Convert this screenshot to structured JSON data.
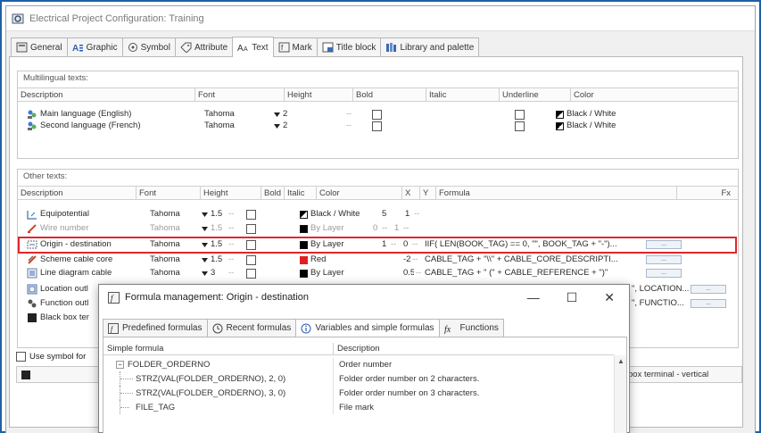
{
  "window": {
    "title": "Electrical Project Configuration: Training"
  },
  "tabs": [
    {
      "label": "General",
      "icon": "general-icon"
    },
    {
      "label": "Graphic",
      "icon": "graphic-icon"
    },
    {
      "label": "Symbol",
      "icon": "symbol-icon"
    },
    {
      "label": "Attribute",
      "icon": "attribute-icon"
    },
    {
      "label": "Text",
      "icon": "text-icon",
      "active": true
    },
    {
      "label": "Mark",
      "icon": "mark-icon"
    },
    {
      "label": "Title block",
      "icon": "title-block-icon"
    },
    {
      "label": "Library and palette",
      "icon": "library-icon"
    }
  ],
  "multilingual": {
    "title": "Multilingual texts:",
    "headers": [
      "Description",
      "Font",
      "Height",
      "Bold",
      "Italic",
      "Underline",
      "Color"
    ],
    "rows": [
      {
        "description": "Main language (English)",
        "font": "Tahoma",
        "height": "2",
        "bold": "--",
        "color": "Black / White"
      },
      {
        "description": "Second language (French)",
        "font": "Tahoma",
        "height": "2",
        "bold": "--",
        "color": "Black / White"
      }
    ]
  },
  "other": {
    "title": "Other texts:",
    "headers": [
      "Description",
      "Font",
      "Height",
      "Bold",
      "Italic",
      "Color",
      "X",
      "Y",
      "Formula",
      "Fx"
    ],
    "rows": [
      {
        "description": "Equipotential",
        "font": "Tahoma",
        "height": "1.5",
        "dash": "--",
        "color": "Black / White",
        "color_hex": "#000000",
        "x": "5",
        "y": "1",
        "y_dash": "--",
        "formula": "",
        "fx": "",
        "faded": false
      },
      {
        "description": "Wire number",
        "font": "Tahoma",
        "height": "1.5",
        "dash": "--",
        "color": "By Layer",
        "color_hex": "#000000",
        "x": "0",
        "x_dash": "--",
        "y": "1",
        "y_dash": "--",
        "formula": "",
        "fx": "",
        "faded": true
      },
      {
        "description": "Origin - destination",
        "font": "Tahoma",
        "height": "1.5",
        "dash": "--",
        "color": "By Layer",
        "color_hex": "#000000",
        "x": "1",
        "x_dash": "--",
        "y": "0",
        "y_dash": "--",
        "formula": "IIF( LEN(BOOK_TAG) == 0, \"\", BOOK_TAG + \"-\")...",
        "fx": "...",
        "faded": false
      },
      {
        "description": "Scheme cable core",
        "font": "Tahoma",
        "height": "1.5",
        "dash": "--",
        "color": "Red",
        "color_hex": "#e02020",
        "x": "",
        "y": "-2",
        "y_dash": "--",
        "formula": "CABLE_TAG + \"\\\\\" + CABLE_CORE_DESCRIPTI...",
        "fx": "...",
        "faded": false
      },
      {
        "description": "Line diagram cable",
        "font": "Tahoma",
        "height": "3",
        "dash": "--",
        "color": "By Layer",
        "color_hex": "#000000",
        "x": "",
        "y": "0.5",
        "y_dash": "--",
        "formula": "CABLE_TAG + \" (\" + CABLE_REFERENCE + \")\"",
        "fx": "...",
        "faded": false
      },
      {
        "description": "Location outl",
        "formula": "\", LOCATION...",
        "fx": "..."
      },
      {
        "description": "Function outl",
        "formula": "\", FUNCTIO...",
        "fx": "..."
      },
      {
        "description": "Black box ter",
        "formula": "",
        "fx": ""
      }
    ]
  },
  "bottom": {
    "checkbox_label": "Use symbol for",
    "status_right": "box terminal - vertical"
  },
  "dialog": {
    "title": "Formula management: Origin - destination",
    "minimize": "—",
    "maximize": "☐",
    "close": "✕",
    "tabs": [
      {
        "label": "Predefined formulas",
        "icon": "formula-icon"
      },
      {
        "label": "Recent formulas",
        "icon": "history-icon"
      },
      {
        "label": "Variables and simple formulas",
        "icon": "info-icon",
        "active": true
      },
      {
        "label": "Functions",
        "icon": "function-icon"
      }
    ],
    "headers": [
      "Simple formula",
      "Description"
    ],
    "rows": [
      {
        "formula": "FOLDER_ORDERNO",
        "description": "Order number",
        "level": 0,
        "expander": "−"
      },
      {
        "formula": "STRZ(VAL(FOLDER_ORDERNO), 2, 0)",
        "description": "Folder order number on 2 characters.",
        "level": 1
      },
      {
        "formula": "STRZ(VAL(FOLDER_ORDERNO), 3, 0)",
        "description": "Folder order number on 3 characters.",
        "level": 1
      },
      {
        "formula": "FILE_TAG",
        "description": "File mark",
        "level": 0
      }
    ]
  },
  "colors": {
    "accent_frame": "#1f5fa8",
    "highlight": "#e0272b",
    "red": "#e02020"
  }
}
